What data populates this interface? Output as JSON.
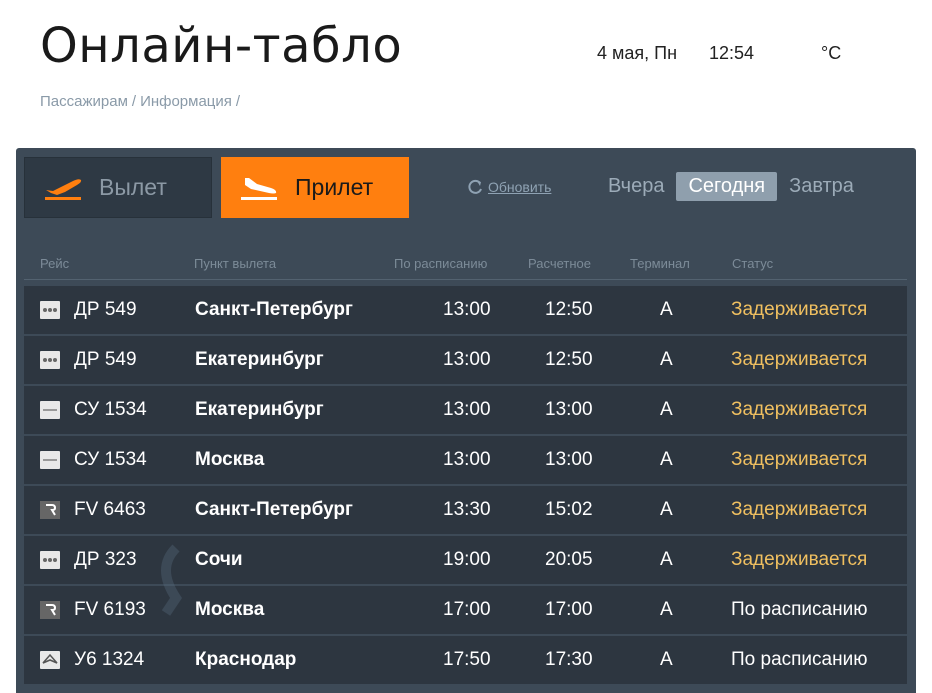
{
  "header": {
    "title": "Онлайн-табло",
    "date": "4 мая, Пн",
    "time": "12:54",
    "temperature": "°C"
  },
  "breadcrumb": [
    "Пассажирам",
    "Информация"
  ],
  "breadcrumb_separator": "/",
  "mode_tabs": {
    "departure": "Вылет",
    "arrival": "Прилет",
    "active": "arrival"
  },
  "refresh_label": "Обновить",
  "day_tabs": [
    "Вчера",
    "Сегодня",
    "Завтра"
  ],
  "active_day": "Сегодня",
  "columns": [
    "Рейс",
    "Пункт вылета",
    "По расписанию",
    "Расчетное",
    "Терминал",
    "Статус"
  ],
  "flights": [
    {
      "logo": "dots-airline-logo",
      "flight": "ДР 549",
      "city": "Санкт-Петербург",
      "scheduled": "13:00",
      "estimated": "12:50",
      "terminal": "A",
      "status": "Задерживается",
      "delayed": true
    },
    {
      "logo": "dots-airline-logo",
      "flight": "ДР 549",
      "city": "Екатеринбург",
      "scheduled": "13:00",
      "estimated": "12:50",
      "terminal": "A",
      "status": "Задерживается",
      "delayed": true
    },
    {
      "logo": "line-airline-logo",
      "flight": "СУ 1534",
      "city": "Екатеринбург",
      "scheduled": "13:00",
      "estimated": "13:00",
      "terminal": "A",
      "status": "Задерживается",
      "delayed": true
    },
    {
      "logo": "line-airline-logo",
      "flight": "СУ 1534",
      "city": "Москва",
      "scheduled": "13:00",
      "estimated": "13:00",
      "terminal": "A",
      "status": "Задерживается",
      "delayed": true
    },
    {
      "logo": "r-airline-logo",
      "flight": "FV 6463",
      "city": "Санкт-Петербург",
      "scheduled": "13:30",
      "estimated": "15:02",
      "terminal": "A",
      "status": "Задерживается",
      "delayed": true
    },
    {
      "logo": "dots-airline-logo",
      "flight": "ДР 323",
      "city": "Сочи",
      "scheduled": "19:00",
      "estimated": "20:05",
      "terminal": "A",
      "status": "Задерживается",
      "delayed": true
    },
    {
      "logo": "r-airline-logo",
      "flight": "FV 6193",
      "city": "Москва",
      "scheduled": "17:00",
      "estimated": "17:00",
      "terminal": "A",
      "status": "По расписанию",
      "delayed": false
    },
    {
      "logo": "u6-airline-logo",
      "flight": "У6 1324",
      "city": "Краснодар",
      "scheduled": "17:50",
      "estimated": "17:30",
      "terminal": "A",
      "status": "По расписанию",
      "delayed": false
    }
  ],
  "colors": {
    "accent": "#ff7f0f",
    "board": "#3d4a57",
    "row": "#2d3640",
    "delayed": "#f0c060"
  }
}
